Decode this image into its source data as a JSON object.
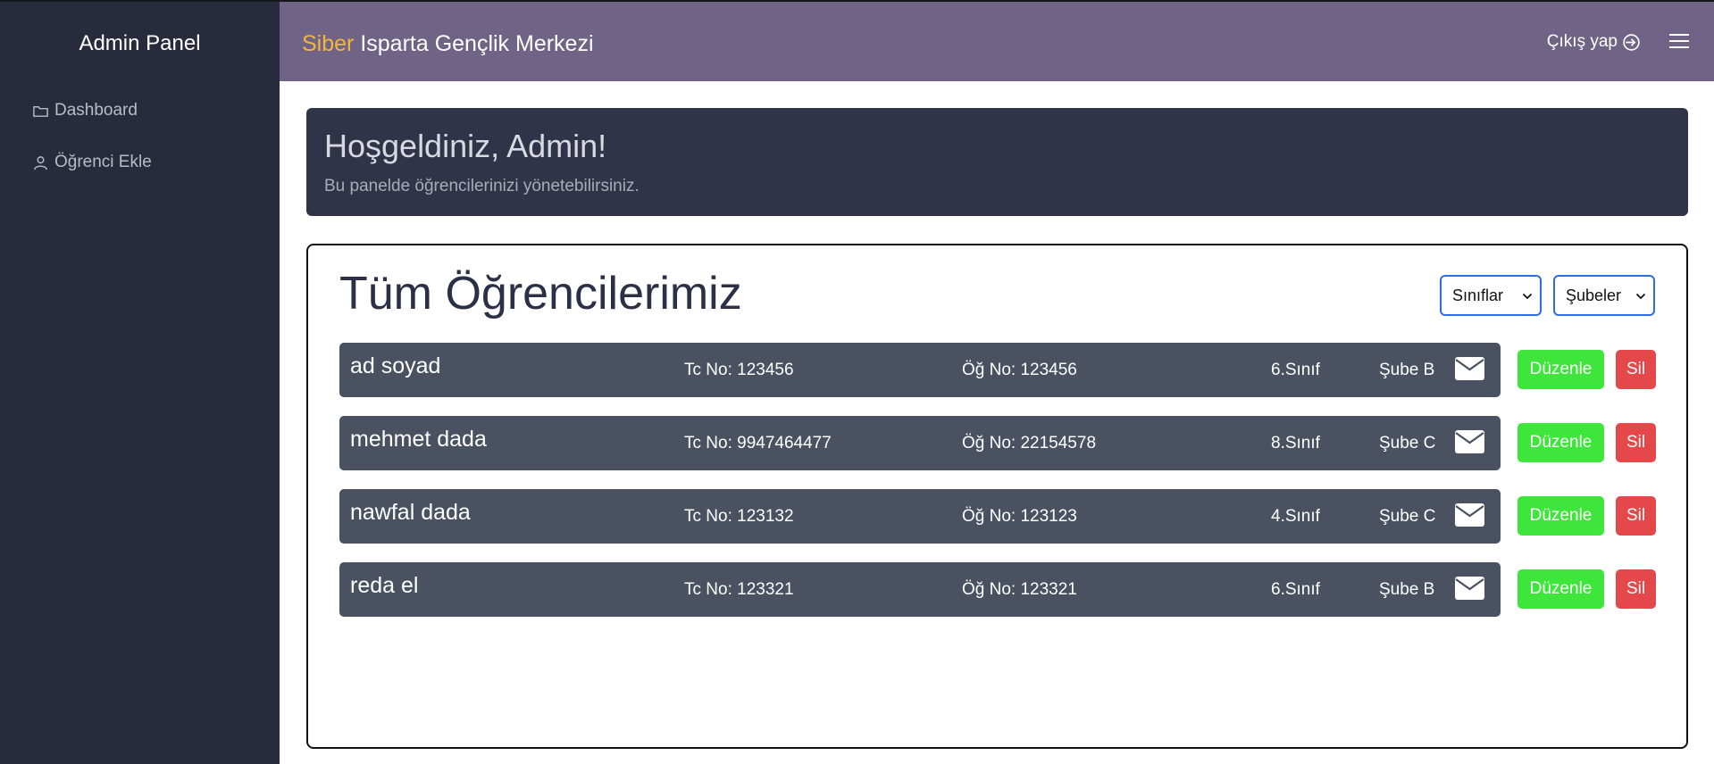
{
  "sidebar": {
    "title": "Admin Panel",
    "items": [
      {
        "label": "Dashboard",
        "icon": "folder-icon"
      },
      {
        "label": "Öğrenci Ekle",
        "icon": "user-icon"
      }
    ]
  },
  "header": {
    "brand_accent": "Siber",
    "brand_rest": " Isparta Gençlik Merkezi",
    "logout_label": "Çıkış yap",
    "logout_icon": "sign-in-icon",
    "menu_icon": "hamburger-icon"
  },
  "welcome": {
    "title": "Hoşgeldiniz, Admin!",
    "subtitle": "Bu panelde öğrencilerinizi yönetebilirsiniz."
  },
  "students_panel": {
    "title": "Tüm Öğrencilerimiz",
    "filter_class": "Sınıflar",
    "filter_branch": "Şubeler",
    "edit_label": "Düzenle",
    "delete_label": "Sil",
    "students": [
      {
        "name": "ad soyad",
        "tc": "Tc No: 123456",
        "og": "Öğ No: 123456",
        "sinif": "6.Sınıf",
        "sube": "Şube B"
      },
      {
        "name": "mehmet dada",
        "tc": "Tc No: 9947464477",
        "og": "Öğ No: 22154578",
        "sinif": "8.Sınıf",
        "sube": "Şube C"
      },
      {
        "name": "nawfal dada",
        "tc": "Tc No: 123132",
        "og": "Öğ No: 123123",
        "sinif": "4.Sınıf",
        "sube": "Şube C"
      },
      {
        "name": "reda el",
        "tc": "Tc No: 123321",
        "og": "Öğ No: 123321",
        "sinif": "6.Sınıf",
        "sube": "Şube B"
      }
    ]
  },
  "colors": {
    "sidebar_bg": "#272b3b",
    "topbar_bg": "#6f6485",
    "brand_accent": "#f4b53f",
    "welcome_bg": "#313449",
    "row_bg": "#4a5262",
    "edit_button": "#3ee63b",
    "delete_button": "#e5484a",
    "select_border": "#2d6de0"
  }
}
